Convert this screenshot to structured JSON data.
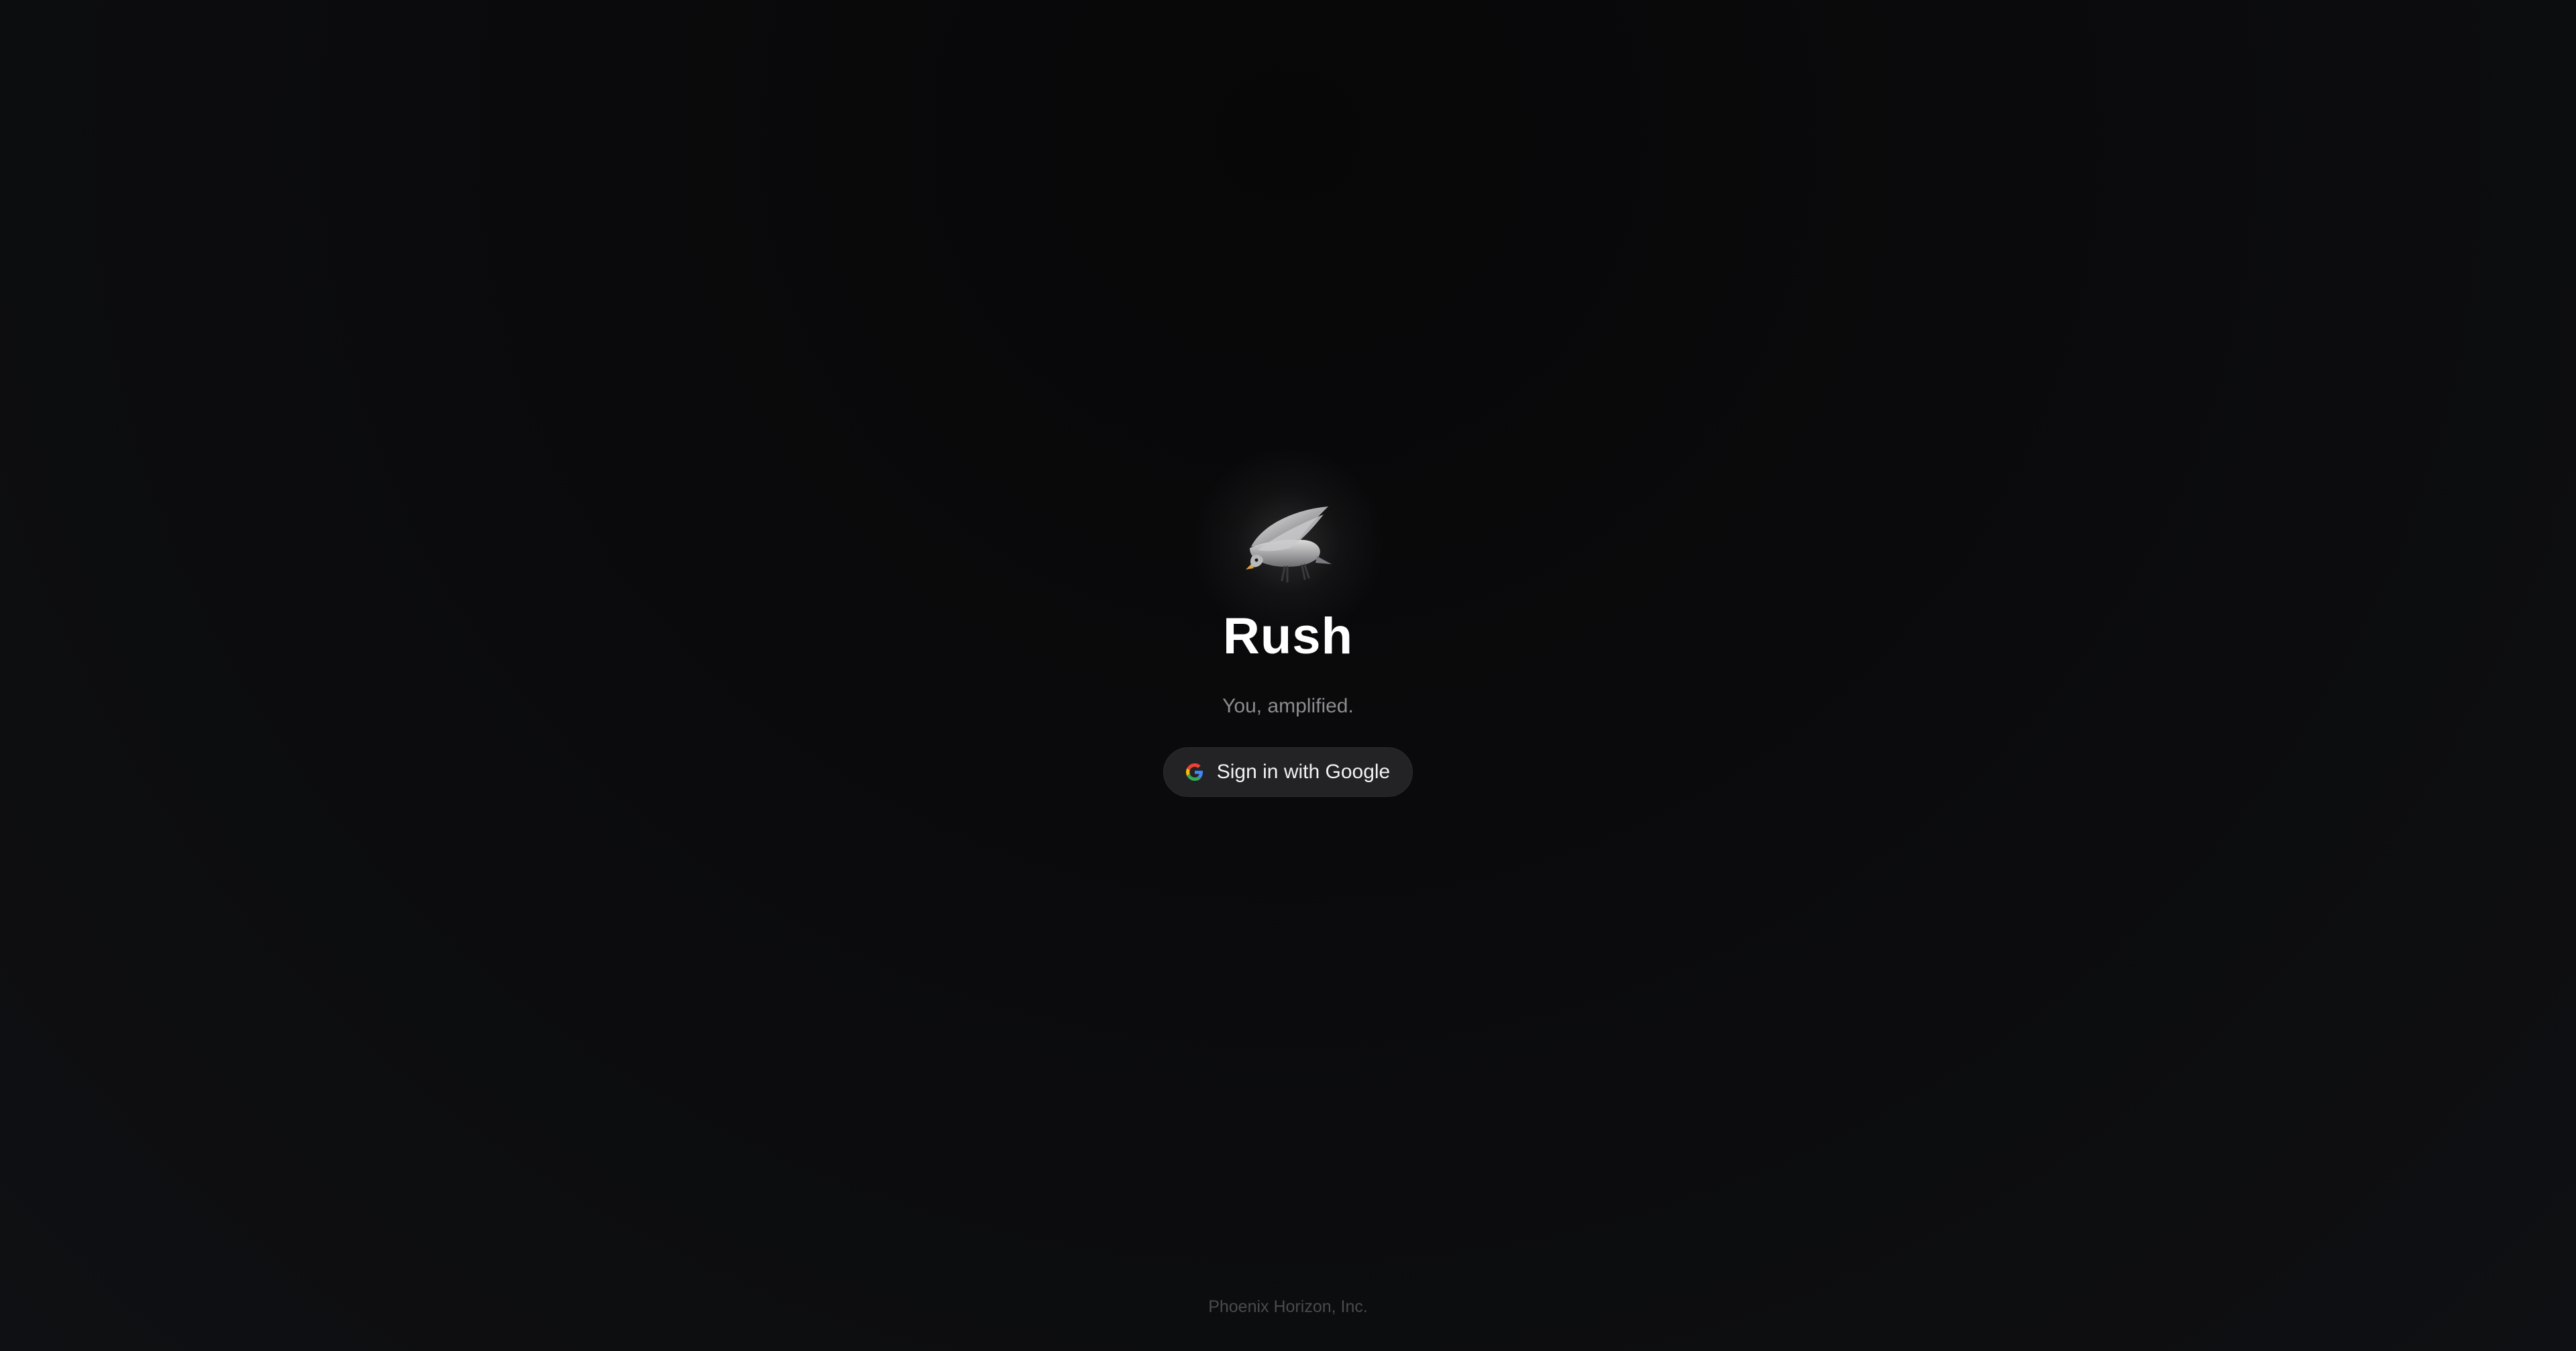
{
  "app": {
    "title": "Rush",
    "tagline": "You, amplified.",
    "logo_icon": "falcon-logo-icon"
  },
  "auth": {
    "google_button_label": "Sign in with Google",
    "google_icon": "google-g-icon"
  },
  "footer": {
    "company": "Phoenix Horizon, Inc."
  },
  "colors": {
    "background": "#0b0b0d",
    "button_bg": "#232326",
    "title": "#ffffff",
    "tagline": "#8c8c91",
    "footer": "#4a4a50"
  }
}
